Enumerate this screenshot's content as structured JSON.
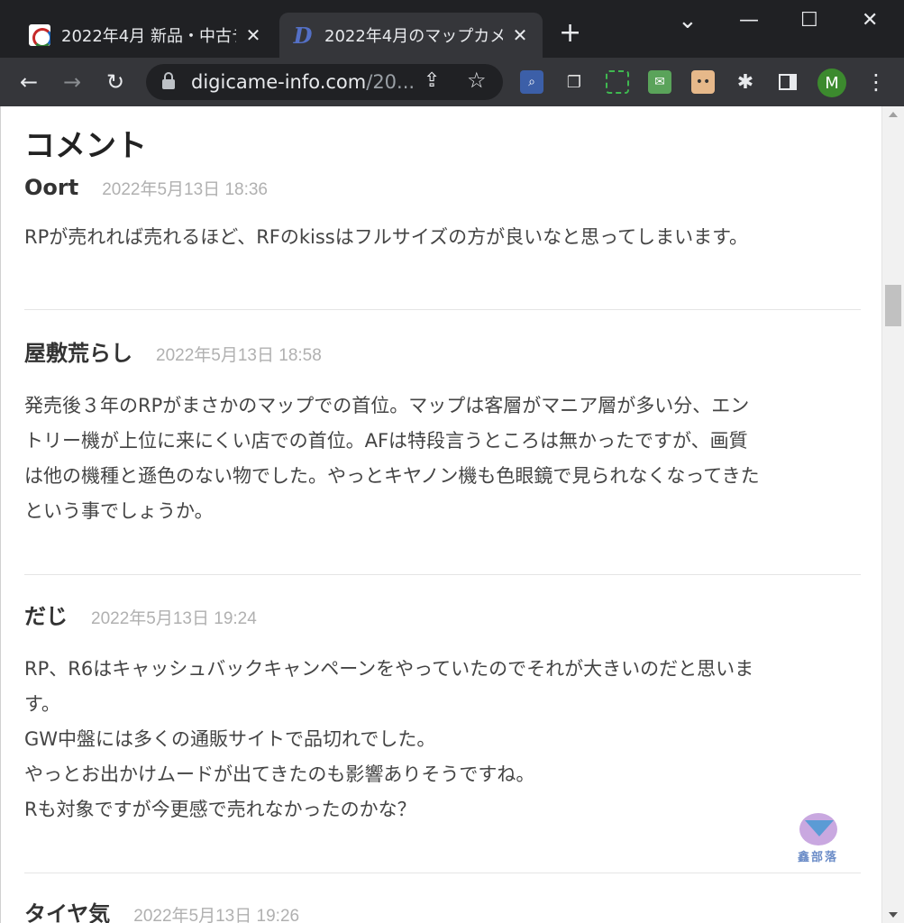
{
  "browser": {
    "tabs": [
      {
        "title": "2022年4月 新品・中古デ",
        "favicon": "camera-site-icon",
        "active": false
      },
      {
        "title": "2022年4月のマップカメ",
        "favicon": "digicame-info-icon",
        "active": true
      }
    ],
    "new_tab": "+",
    "window_controls": {
      "menu": "⌄",
      "minimize": "—",
      "maximize": "☐",
      "close": "✕"
    },
    "nav": {
      "back": "←",
      "forward": "→",
      "reload": "↻"
    },
    "url": "digicame-info.com",
    "url_path": "/20...",
    "profile_initial": "M",
    "menu": "⋮",
    "extensions": [
      "search-extension-icon",
      "notes-extension-icon",
      "screenshot-extension-icon",
      "mail-extension-icon",
      "face-extension-icon",
      "puzzle-icon",
      "sidebar-icon"
    ]
  },
  "page": {
    "heading": "コメント",
    "comments": [
      {
        "author": "Oort",
        "date": "2022年5月13日 18:36",
        "body": [
          "RPが売れれば売れるほど、RFのkissはフルサイズの方が良いなと思ってしまいます。"
        ]
      },
      {
        "author": "屋敷荒らし",
        "date": "2022年5月13日 18:58",
        "body": [
          "発売後３年のRPがまさかのマップでの首位。マップは客層がマニア層が多い分、エン",
          "トリー機が上位に来にくい店での首位。AFは特段言うところは無かったですが、画質",
          "は他の機種と遜色のない物でした。やっとキヤノン機も色眼鏡で見られなくなってきた",
          "という事でしょうか。"
        ]
      },
      {
        "author": "だじ",
        "date": "2022年5月13日 19:24",
        "body": [
          "RP、R6はキャッシュバックキャンペーンをやっていたのでそれが大きいのだと思いま",
          "す。",
          "GW中盤には多くの通販サイトで品切れでした。",
          "やっとお出かけムードが出てきたのも影響ありそうですね。",
          "Rも対象ですが今更感で売れなかったのかな？"
        ]
      },
      {
        "author": "タイヤ気",
        "date": "2022年5月13日 19:26",
        "body": []
      }
    ],
    "watermark": "鑫部落"
  },
  "colors": {
    "chrome_dark": "#202124",
    "toolbar": "#35363a",
    "date_gray": "#b0b0b0"
  }
}
